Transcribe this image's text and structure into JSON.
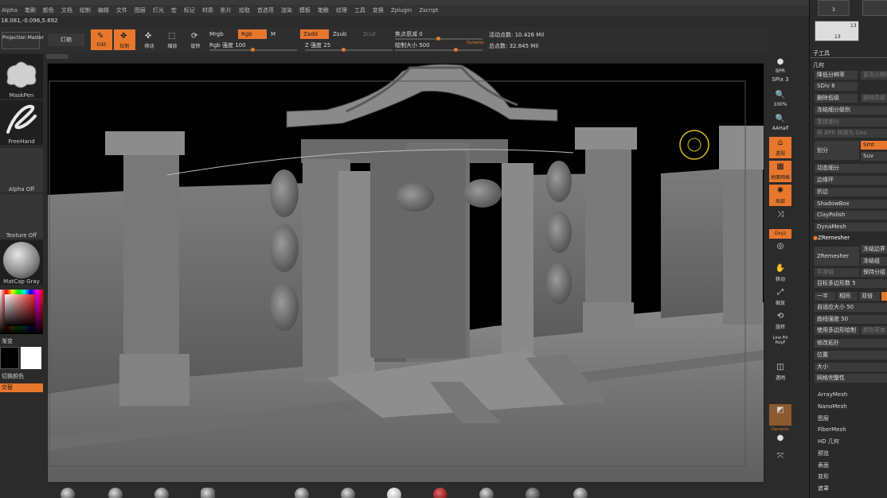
{
  "menu": [
    "Alpha",
    "笔刷",
    "颜色",
    "文档",
    "绘制",
    "编辑",
    "文件",
    "图层",
    "灯光",
    "宏",
    "标记",
    "材质",
    "影片",
    "拾取",
    "首选项",
    "渲染",
    "模板",
    "笔触",
    "纹理",
    "工具",
    "变换",
    "Zplugin",
    "Zscript"
  ],
  "coords": "18.081,-0.096,5.692",
  "toolbar": {
    "projection_master": "Projection Master",
    "lightbox": "灯箱",
    "edit": "Edit",
    "draw": "绘制",
    "move": "移动",
    "scale": "缩放",
    "rotate": "旋转",
    "mrgb": "Mrgb",
    "rgb": "Rgb",
    "m": "M",
    "zadd": "Zadd",
    "zsub": "Zsub",
    "zcut": "Zcut",
    "rgb_intensity": "Rgb 强度 100",
    "z_intensity": "Z 强度 25",
    "focal_shift": "焦点衰减 0",
    "draw_size": "绘制大小 500",
    "dynamic": "Dynamic",
    "active_points": "活动点数: 10.426 Mil",
    "total_points": "总点数: 32.845 Mil"
  },
  "left": {
    "maskpen": "MaskPen",
    "freehand": "FreeHand",
    "alpha_off": "Alpha Off",
    "texture_off": "Texture Off",
    "matcap": "MatCap Gray",
    "gradient": "渐变",
    "switch_color": "切换颜色",
    "alternate": "交替"
  },
  "right_tools": {
    "bpr": "BPR",
    "spix": "SPix 3",
    "zoom_pct": "100%",
    "zoom_half": "AAHalf",
    "persp": "透视",
    "floor": "地面网格",
    "local": "局部",
    "xyz": "Gxyz",
    "frame": "移动",
    "scale": "缩放",
    "rotate": "旋转",
    "linefill": "Line Fill",
    "polyf": "PolyF",
    "transp": "透明",
    "dynamic": "Dynamic",
    "solo": "单独"
  },
  "panel": {
    "counter": "3",
    "sub_count": "13",
    "subtool": "子工具",
    "geometry": "几何",
    "lower_res": "降低分辨率",
    "higher_res": "更高分辨率",
    "sdiv": "SDiv 8",
    "del_lower": "删除低级",
    "del_higher": "删除高级",
    "freeze_sub": "冻结细分级别",
    "reconstruct": "重建细分",
    "bpr_to_geo": "将 BPR 转换为 Geo",
    "divide": "划分",
    "smt": "Smt",
    "suv": "Suv",
    "dyn_subdiv": "动态细分",
    "edge_loop": "边缘环",
    "crease": "折边",
    "shadowbox": "ShadowBox",
    "claypolish": "ClayPolish",
    "dynamesh": "DynaMesh",
    "zremesher_head": "ZRemesher",
    "zremesher_btn": "ZRemesher",
    "freeze_border": "冻结边界",
    "freeze_groups": "冻结组",
    "smooth_groups": "平滑组",
    "keep_groups": "保持分组",
    "target_poly": "目标多边形数 5",
    "half": "一半",
    "same": "相同",
    "double": "双倍",
    "adapt_size": "自适应大小 50",
    "curve_strength": "曲线强度 50",
    "use_poly_paint": "使用多边形绘制",
    "color_density": "颜色密度",
    "modify_topology": "修改拓扑",
    "position": "位置",
    "size": "大小",
    "mesh_integrity": "网格完整性",
    "arraymesh": "ArrayMesh",
    "nanomesh": "NanoMesh",
    "layers": "图层",
    "fibermesh": "FiberMesh",
    "hd_geo": "HD 几何",
    "preview": "预览",
    "surface": "表面",
    "deformation": "变形",
    "masking": "遮罩"
  },
  "colors": {
    "accent": "#e8772e",
    "bg": "#2b2b2b"
  }
}
